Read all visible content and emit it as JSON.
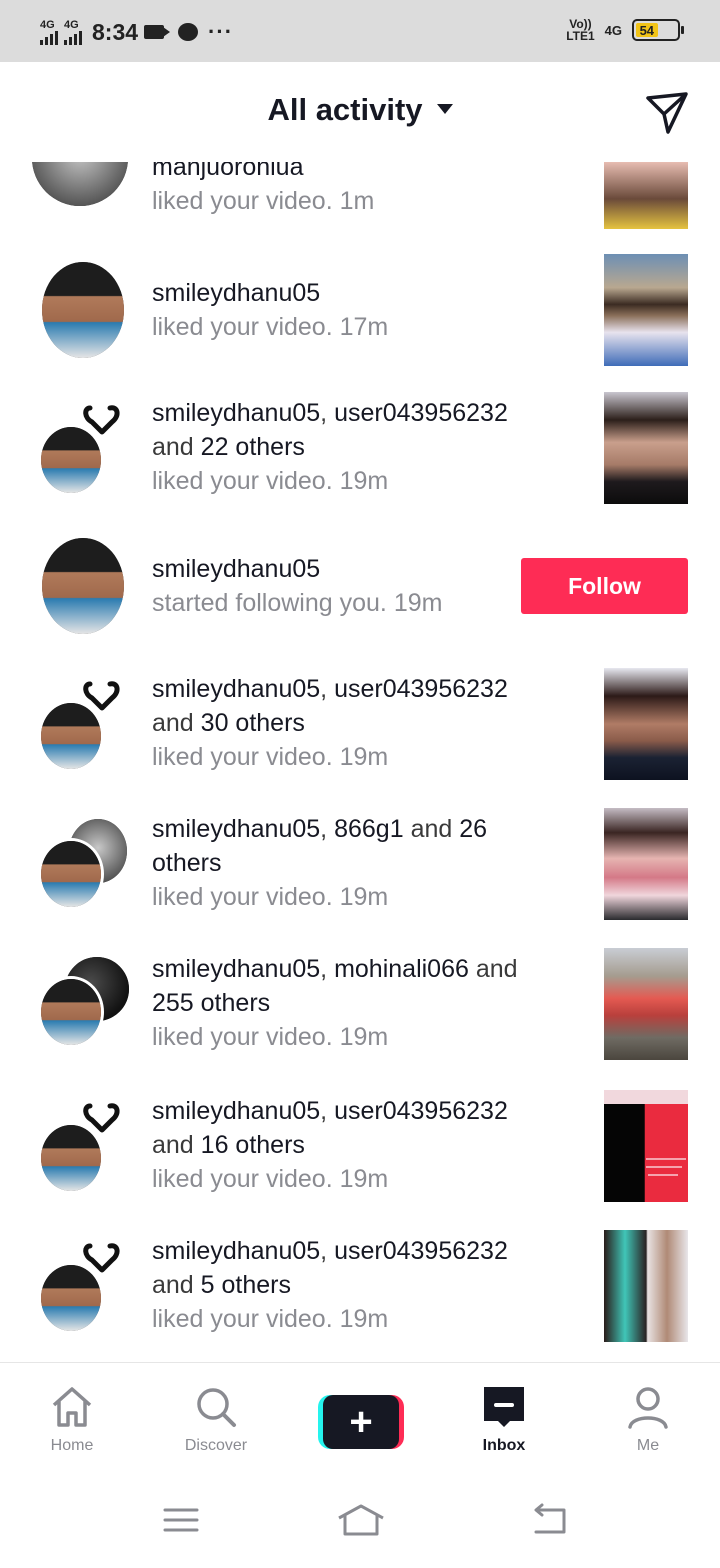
{
  "status_bar": {
    "sim1_label": "4G",
    "sim2_label": "4G",
    "time": "8:34",
    "more": "···",
    "volte_top": "Vo))",
    "volte_bottom": "LTE1",
    "network": "4G",
    "battery": "54",
    "battery_level": 0.54,
    "battery_color": "#f2c417"
  },
  "header": {
    "title": "All activity",
    "dropdown_icon": "caret-down-icon",
    "dm_icon": "paper-plane-icon"
  },
  "colors": {
    "accent": "#fe2c55",
    "text_primary": "#161823",
    "text_secondary": "#8a8b91"
  },
  "notifications": [
    {
      "username": "manjuoroniua",
      "action": "liked your video.",
      "time": "1m"
    },
    {
      "username": "smileydhanu05",
      "action": "liked your video.",
      "time": "17m"
    },
    {
      "username": "smileydhanu05",
      "sep": ",",
      "second_user": "user043956232",
      "and": "and",
      "others": "22 others",
      "action": "liked your video.",
      "time": "19m"
    },
    {
      "username": "smileydhanu05",
      "action": "started following you.",
      "time": "19m",
      "button": "Follow"
    },
    {
      "username": "smileydhanu05",
      "sep": ",",
      "second_user": "user043956232",
      "and": "and",
      "others": "30 others",
      "action": "liked your video.",
      "time": "19m"
    },
    {
      "username": "smileydhanu05",
      "sep": ",",
      "second_user": "866g1",
      "and": "and",
      "others_num": "26",
      "others_word": "others",
      "action": "liked your video.",
      "time": "19m"
    },
    {
      "username": "smileydhanu05",
      "sep": ",",
      "second_user": "mohinali066",
      "and": "and",
      "others": "255 others",
      "action": "liked your video.",
      "time": "19m"
    },
    {
      "username": "smileydhanu05",
      "sep": ",",
      "second_user": "user043956232",
      "and": "and",
      "others": "16 others",
      "action": "liked your video.",
      "time": "19m"
    },
    {
      "username": "smileydhanu05",
      "sep": ",",
      "second_user": "user043956232",
      "and": "and",
      "others": "5 others",
      "action": "liked your video.",
      "time": "19m"
    }
  ],
  "bottom_nav": {
    "home": "Home",
    "discover": "Discover",
    "create": "+",
    "inbox": "Inbox",
    "me": "Me",
    "active": "Inbox"
  },
  "system_nav": {
    "menu_icon": "menu-icon",
    "home_icon": "home-outline-icon",
    "back_icon": "back-icon"
  }
}
